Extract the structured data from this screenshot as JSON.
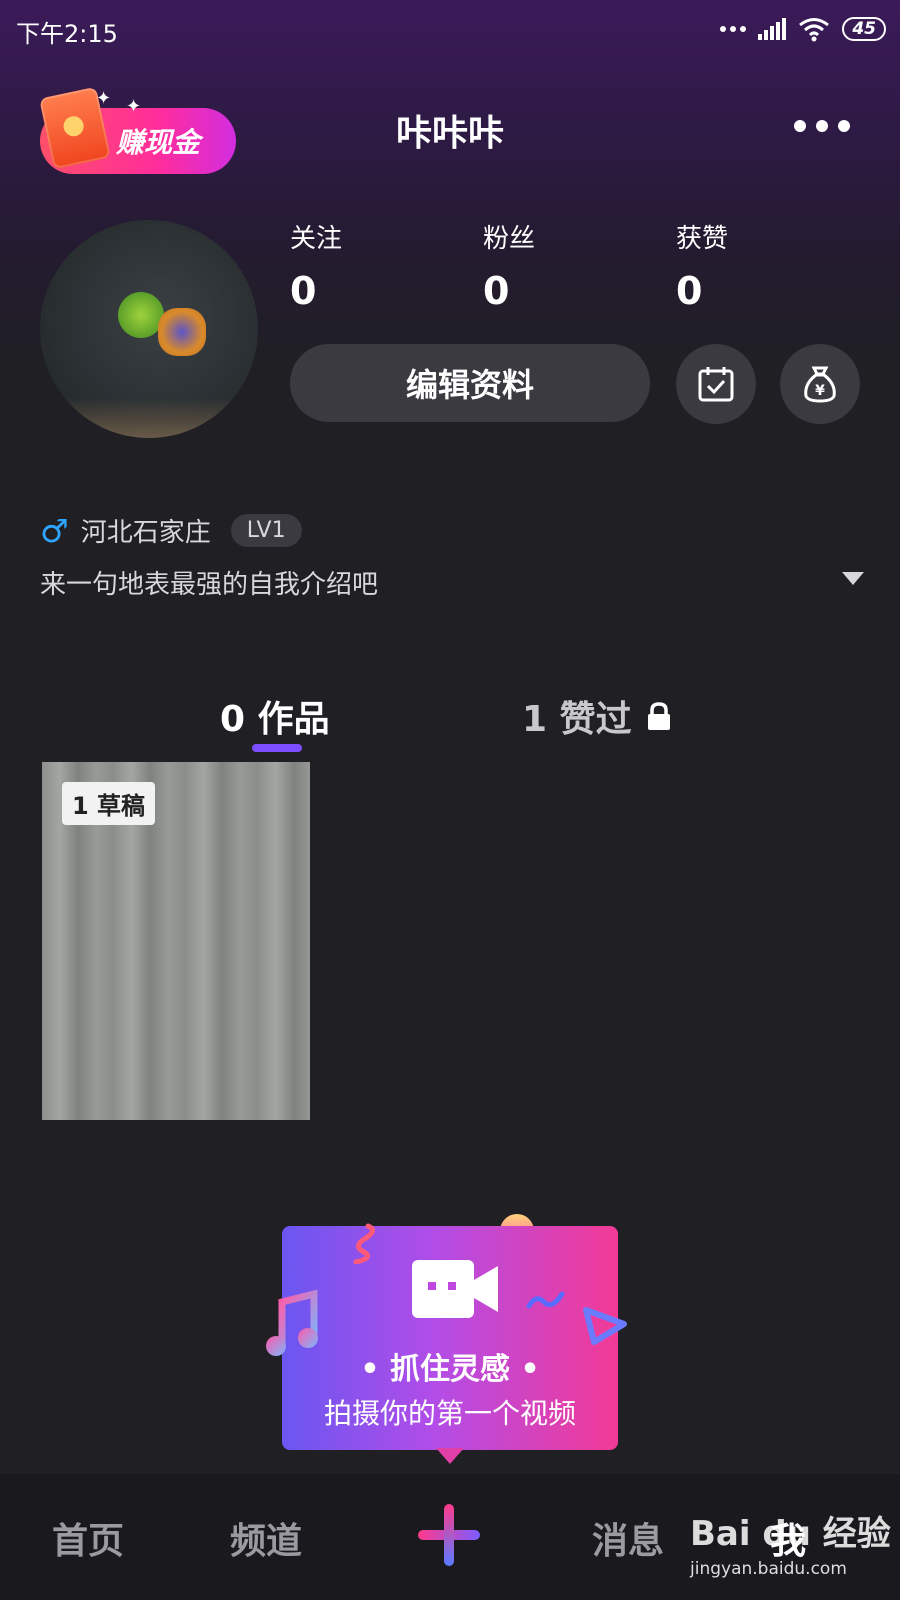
{
  "status_bar": {
    "time": "下午2:15",
    "battery": "45"
  },
  "header": {
    "earn_label": "赚现金",
    "title": "咔咔咔"
  },
  "profile": {
    "stats": [
      {
        "label": "关注",
        "value": "0"
      },
      {
        "label": "粉丝",
        "value": "0"
      },
      {
        "label": "获赞",
        "value": "0"
      }
    ],
    "edit_button": "编辑资料",
    "location": "河北石家庄",
    "level": "LV1",
    "bio": "来一句地表最强的自我介绍吧"
  },
  "tabs": [
    {
      "label": "0 作品",
      "active": true
    },
    {
      "label": "1 赞过",
      "locked": true
    }
  ],
  "draft": {
    "badge": "1 草稿"
  },
  "cta": {
    "title": "• 抓住灵感 •",
    "subtitle": "拍摄你的第一个视频"
  },
  "bottom_nav": {
    "home": "首页",
    "channel": "频道",
    "messages": "消息",
    "me": "我"
  },
  "watermark": {
    "brand": "Bai du 经验",
    "url": "jingyan.baidu.com"
  },
  "colors": {
    "accent": "#7b4dff",
    "male": "#2ea6ff",
    "cta_start": "#6a56f0",
    "cta_end": "#f23a96"
  }
}
